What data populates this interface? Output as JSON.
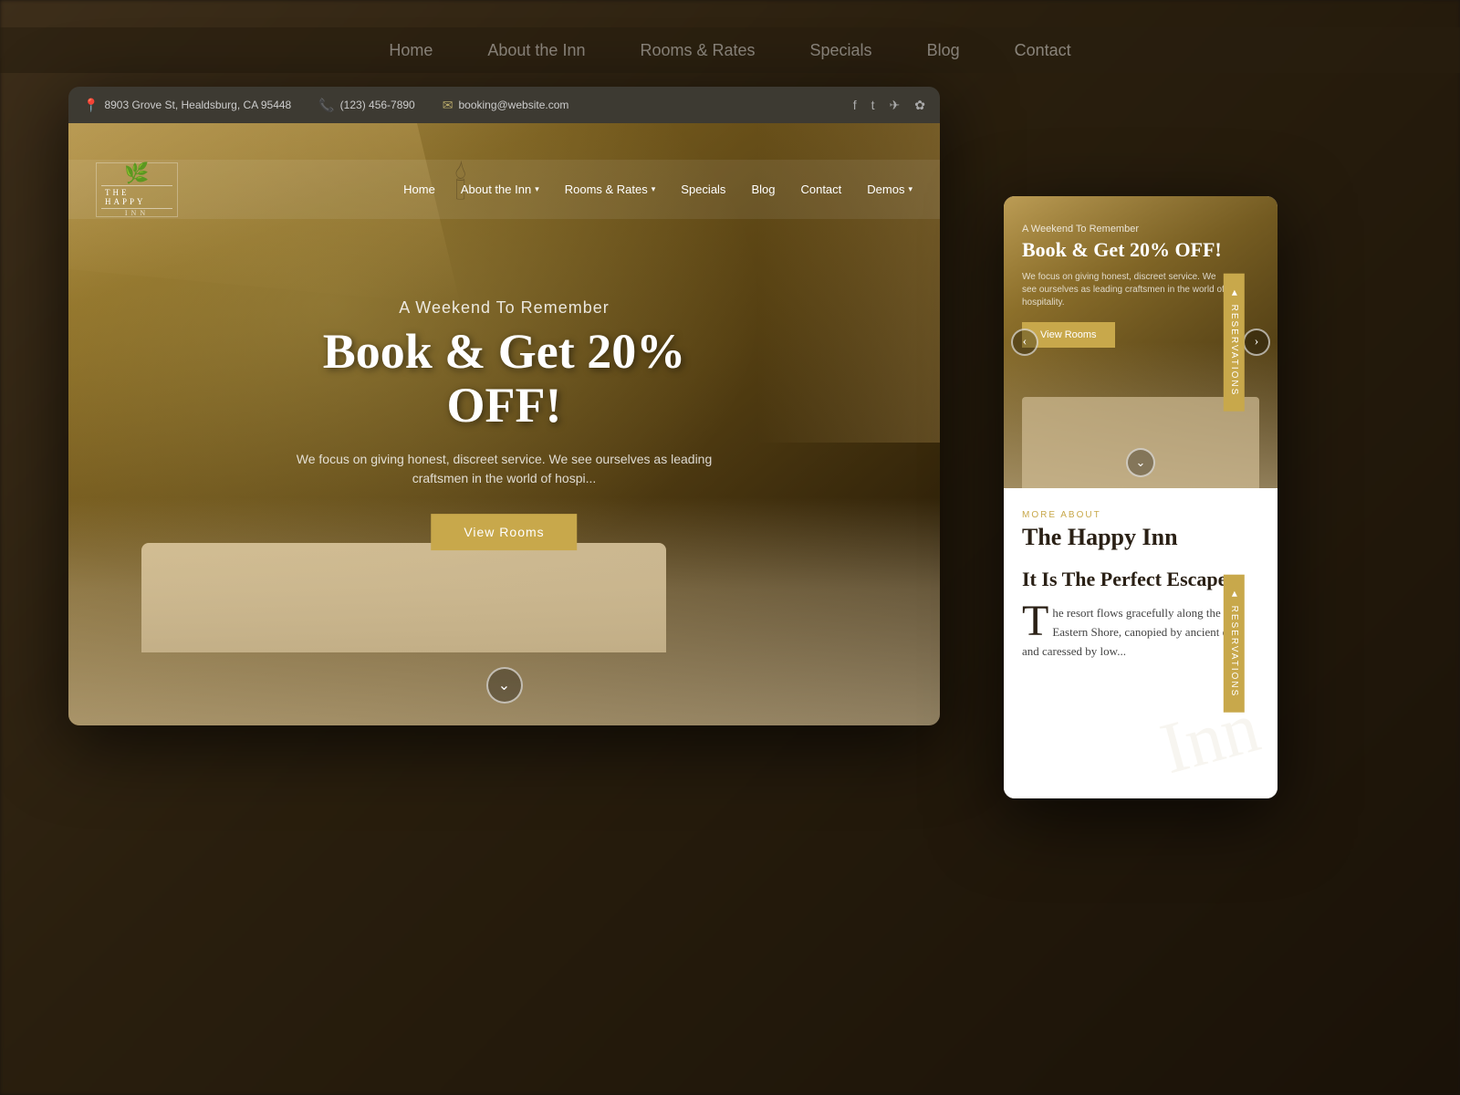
{
  "background": {
    "nav_items": [
      "Home",
      "About the Inn",
      "Rooms & Rates",
      "Specials",
      "Blog",
      "Contact"
    ]
  },
  "top_bar": {
    "address": "8903 Grove St, Healdsburg, CA 95448",
    "phone": "(123) 456-7890",
    "email": "booking@website.com"
  },
  "nav": {
    "logo_main": "THE HAPPY",
    "logo_sub": "INN",
    "items": [
      {
        "label": "Home",
        "has_dropdown": false
      },
      {
        "label": "About the Inn",
        "has_dropdown": true
      },
      {
        "label": "Rooms & Rates",
        "has_dropdown": true
      },
      {
        "label": "Specials",
        "has_dropdown": false
      },
      {
        "label": "Blog",
        "has_dropdown": false
      },
      {
        "label": "Contact",
        "has_dropdown": false
      },
      {
        "label": "Demos",
        "has_dropdown": true
      }
    ]
  },
  "hero": {
    "subtitle": "A Weekend To Remember",
    "title": "Book & Get 20% OFF!",
    "description": "We focus on giving honest, discreet service. We see ourselves as leading craftsmen in the world of hospi...",
    "btn_label": "View Rooms"
  },
  "win2_hero": {
    "subtitle": "A Weekend To Remember",
    "title": "Book & Get 20% OFF!",
    "description": "We focus on giving honest, discreet service. We see ourselves as leading craftsmen in the world of hospitality.",
    "btn_label": "View Rooms"
  },
  "win2_bottom": {
    "more_about_label": "MORE ABOUT",
    "inn_title": "The Happy Inn",
    "escape_title": "It Is The Perfect Escape",
    "body_text": "he resort flows gracefully along the Eastern Shore, canopied by ancient oaks and caressed by low...",
    "drop_cap": "T",
    "watermark": "Inn"
  },
  "reservations": {
    "label": "RESERVATIONS",
    "arrow": "🢐"
  }
}
